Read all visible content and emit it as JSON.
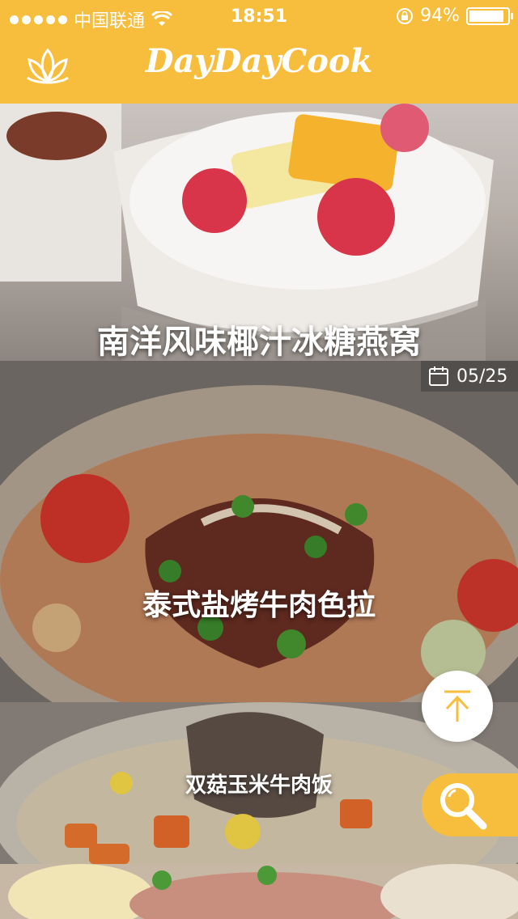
{
  "status": {
    "carrier": "中国联通",
    "time": "18:51",
    "battery": "94%"
  },
  "header": {
    "brand": "DayDayCook"
  },
  "recipes": [
    {
      "title": "南洋风味椰汁冰糖燕窝"
    },
    {
      "title": "泰式盐烤牛肉色拉",
      "date": "05/25"
    },
    {
      "title": "双菇玉米牛肉饭"
    },
    {
      "title": ""
    }
  ],
  "colors": {
    "accent": "#f7be3e"
  }
}
